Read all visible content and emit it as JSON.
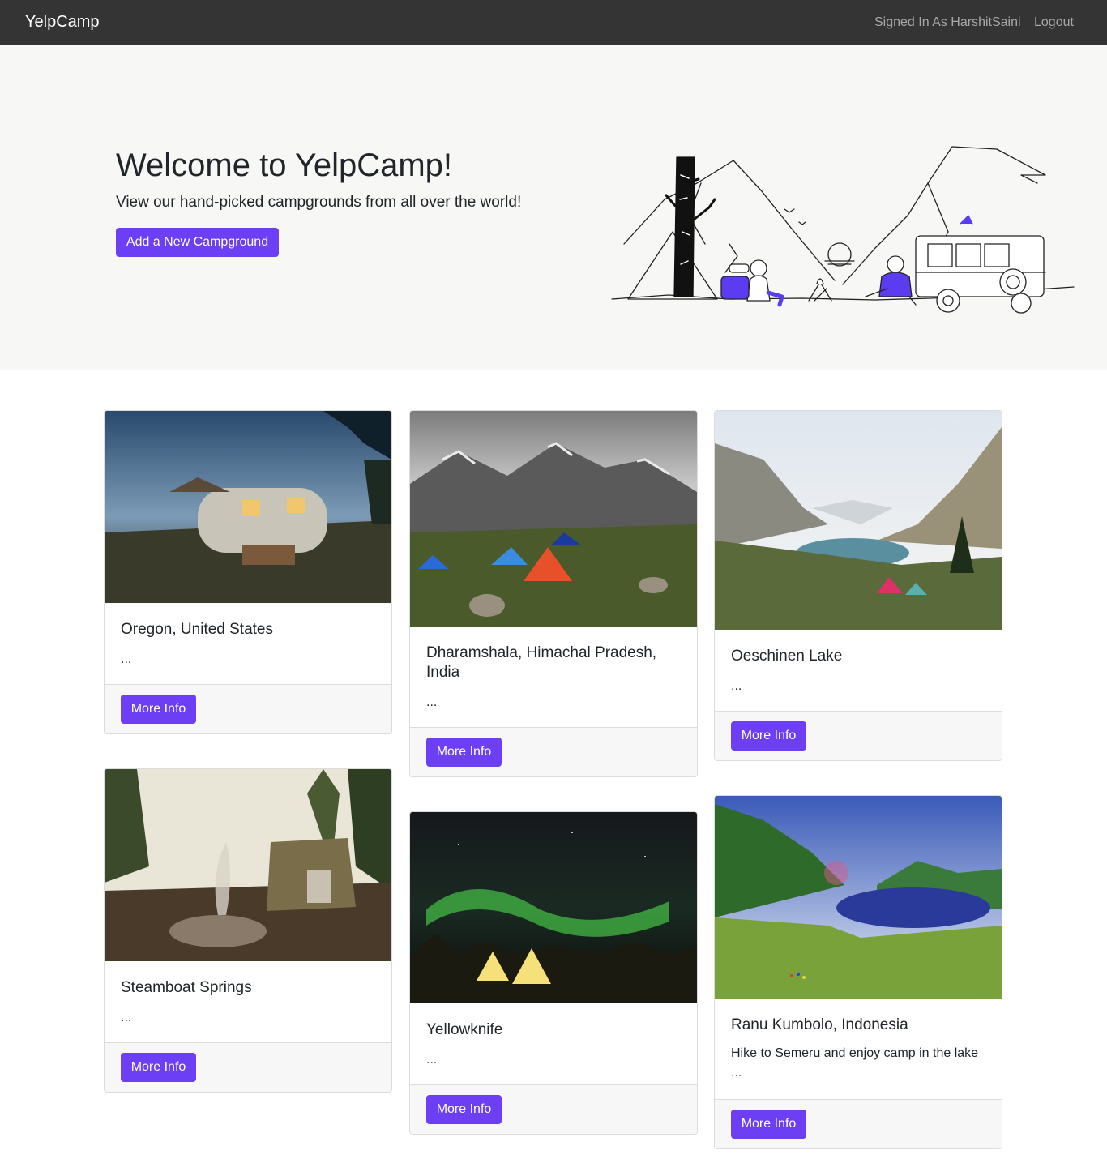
{
  "navbar": {
    "brand": "YelpCamp",
    "signed_in": "Signed In As HarshitSaini",
    "logout": "Logout"
  },
  "hero": {
    "title": "Welcome to YelpCamp!",
    "subtitle": "View our hand-picked campgrounds from all over the world!",
    "button": "Add a New Campground"
  },
  "colors": {
    "accent": "#6c3ef4",
    "navbar": "#343434",
    "hero_bg": "#f7f7f5"
  },
  "campgrounds": [
    {
      "title": "Oregon, United States",
      "description": "",
      "ellipsis": "...",
      "button": "More Info",
      "image": "vintage-trailer-camp-photo"
    },
    {
      "title": "Dharamshala, Himachal Pradesh, India",
      "description": "",
      "ellipsis": "...",
      "button": "More Info",
      "image": "mountain-tents-photo"
    },
    {
      "title": "Oeschinen Lake",
      "description": "",
      "ellipsis": "...",
      "button": "More Info",
      "image": "alpine-lake-photo"
    },
    {
      "title": "Steamboat Springs",
      "description": "",
      "ellipsis": "...",
      "button": "More Info",
      "image": "campfire-forest-photo"
    },
    {
      "title": "Yellowknife",
      "description": "",
      "ellipsis": "...",
      "button": "More Info",
      "image": "aurora-teepees-photo"
    },
    {
      "title": "Ranu Kumbolo, Indonesia",
      "description": "Hike to Semeru and enjoy camp in the lake",
      "ellipsis": "...",
      "button": "More Info",
      "image": "green-valley-lake-photo"
    }
  ]
}
